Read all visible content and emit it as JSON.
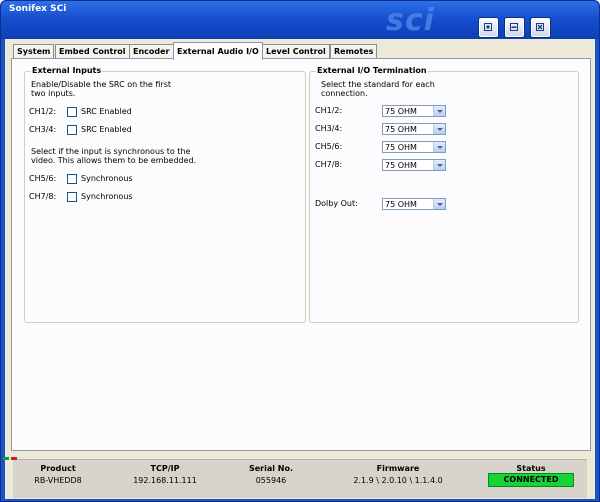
{
  "window": {
    "title": "Sonifex SCi",
    "logo": "sci"
  },
  "tabs": [
    "System",
    "Embed Control",
    "Encoder",
    "External Audio I/O",
    "Level Control",
    "Remotes"
  ],
  "external_inputs": {
    "title": "External Inputs",
    "desc1_l1": "Enable/Disable the SRC on the first",
    "desc1_l2": "two inputs.",
    "ch12_label": "CH1/2:",
    "ch12_cb": "SRC Enabled",
    "ch34_label": "CH3/4:",
    "ch34_cb": "SRC Enabled",
    "desc2_l1": "Select if the input is synchronous to the",
    "desc2_l2": "video. This allows them to be embedded.",
    "ch56_label": "CH5/6:",
    "ch56_cb": "Synchronous",
    "ch78_label": "CH7/8:",
    "ch78_cb": "Synchronous"
  },
  "external_termination": {
    "title": "External I/O Termination",
    "desc_l1": "Select the standard for each",
    "desc_l2": "connection.",
    "ch12_label": "CH1/2:",
    "ch12_value": "75 OHM",
    "ch34_label": "CH3/4:",
    "ch34_value": "75 OHM",
    "ch56_label": "CH5/6:",
    "ch56_value": "75 OHM",
    "ch78_label": "CH7/8:",
    "ch78_value": "75 OHM",
    "dolby_label": "Dolby Out:",
    "dolby_value": "75 OHM"
  },
  "status_bar": {
    "product_label": "Product",
    "product_value": "RB-VHEDD8",
    "tcpip_label": "TCP/IP",
    "tcpip_value": "192.168.11.111",
    "serial_label": "Serial No.",
    "serial_value": "055946",
    "firmware_label": "Firmware",
    "firmware_value": "2.1.9 \\ 2.0.10 \\ 1.1.4.0",
    "status_label": "Status",
    "status_value": "CONNECTED",
    "status_color": "#16d436"
  }
}
